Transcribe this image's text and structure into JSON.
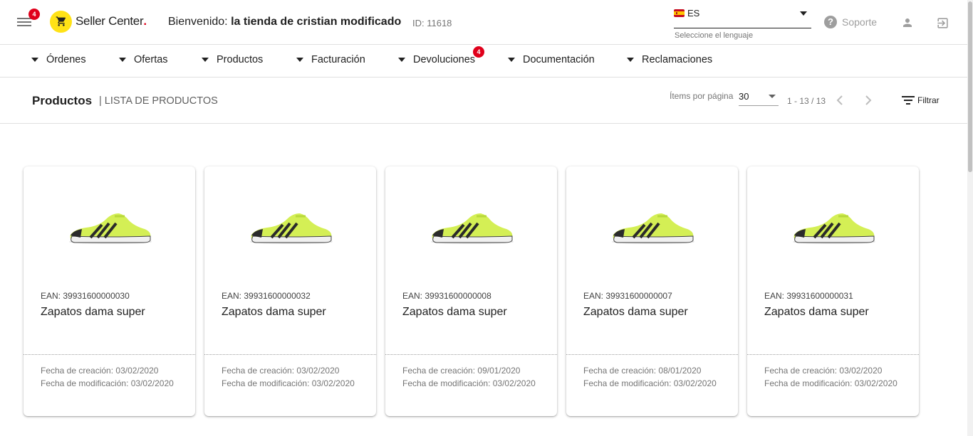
{
  "header": {
    "menu_badge": "4",
    "logo_text": "Seller Center",
    "logo_dot": ".",
    "welcome_prefix": "Bienvenido:",
    "store_name": "la tienda de cristian modificado",
    "store_id": "ID: 11618",
    "language": {
      "code": "ES",
      "hint": "Seleccione el lenguaje"
    },
    "support_label": "Soporte"
  },
  "nav": {
    "items": [
      {
        "label": "Órdenes"
      },
      {
        "label": "Ofertas"
      },
      {
        "label": "Productos"
      },
      {
        "label": "Facturación"
      },
      {
        "label": "Devoluciones",
        "badge": "4"
      },
      {
        "label": "Documentación"
      },
      {
        "label": "Reclamaciones"
      }
    ]
  },
  "subheader": {
    "title": "Productos",
    "subtitle": "| LISTA DE PRODUCTOS",
    "items_per_page_label": "Ítems por página",
    "items_per_page_value": "30",
    "range": "1 - 13 / 13",
    "filter_label": "Filtrar"
  },
  "products": [
    {
      "ean": "EAN: 39931600000030",
      "name": "Zapatos dama super",
      "created": "Fecha de creación: 03/02/2020",
      "modified": "Fecha de modificación: 03/02/2020"
    },
    {
      "ean": "EAN: 39931600000032",
      "name": "Zapatos dama super",
      "created": "Fecha de creación: 03/02/2020",
      "modified": "Fecha de modificación: 03/02/2020"
    },
    {
      "ean": "EAN: 39931600000008",
      "name": "Zapatos dama super",
      "created": "Fecha de creación: 09/01/2020",
      "modified": "Fecha de modificación: 03/02/2020"
    },
    {
      "ean": "EAN: 39931600000007",
      "name": "Zapatos dama super",
      "created": "Fecha de creación: 08/01/2020",
      "modified": "Fecha de modificación: 03/02/2020"
    },
    {
      "ean": "EAN: 39931600000031",
      "name": "Zapatos dama super",
      "created": "Fecha de creación: 03/02/2020",
      "modified": "Fecha de modificación: 03/02/2020"
    }
  ],
  "colors": {
    "brand_yellow": "#ffe216",
    "badge_red": "#e0001b"
  }
}
